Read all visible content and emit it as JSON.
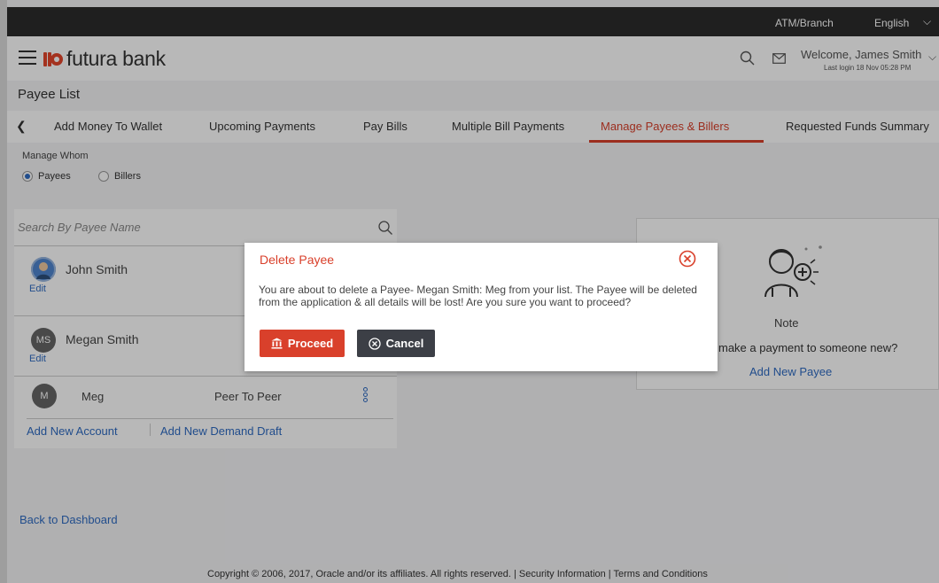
{
  "topbar": {
    "atm_branch": "ATM/Branch",
    "language": "English"
  },
  "header": {
    "brand": "futura bank",
    "welcome": "Welcome, James Smith",
    "last_login": "Last login 18 Nov 05:28 PM"
  },
  "page": {
    "title": "Payee List"
  },
  "tabs": [
    {
      "label": "Add Money To Wallet"
    },
    {
      "label": "Upcoming Payments"
    },
    {
      "label": "Pay Bills"
    },
    {
      "label": "Multiple Bill Payments"
    },
    {
      "label": "Manage Payees & Billers",
      "active": true
    },
    {
      "label": "Requested Funds Summary"
    }
  ],
  "manage": {
    "label": "Manage Whom",
    "options": [
      {
        "label": "Payees",
        "selected": true
      },
      {
        "label": "Billers",
        "selected": false
      }
    ]
  },
  "search": {
    "placeholder": "Search By Payee Name"
  },
  "payees": [
    {
      "name": "John Smith",
      "edit": "Edit"
    },
    {
      "name": "Megan Smith",
      "initials": "MS",
      "edit": "Edit"
    }
  ],
  "account": {
    "initial": "M",
    "name": "Meg",
    "type": "Peer To Peer"
  },
  "actions": {
    "add_account": "Add New Account",
    "add_dd": "Add New Demand Draft"
  },
  "note": {
    "title": "Note",
    "text": "make a payment to someone new?",
    "link": "Add New Payee"
  },
  "back_link": "Back to Dashboard",
  "footer": "Copyright © 2006, 2017, Oracle and/or its affiliates. All rights reserved. | Security Information | Terms and Conditions",
  "modal": {
    "title": "Delete Payee",
    "message": "You are about to delete a Payee- Megan Smith: Meg from your list. The Payee will be deleted from the application & all details will be lost! Are you sure you want to proceed?",
    "proceed": "Proceed",
    "cancel": "Cancel"
  },
  "colors": {
    "accent": "#d9402b",
    "link": "#2f6bc2",
    "dark": "#2b2b2b"
  }
}
